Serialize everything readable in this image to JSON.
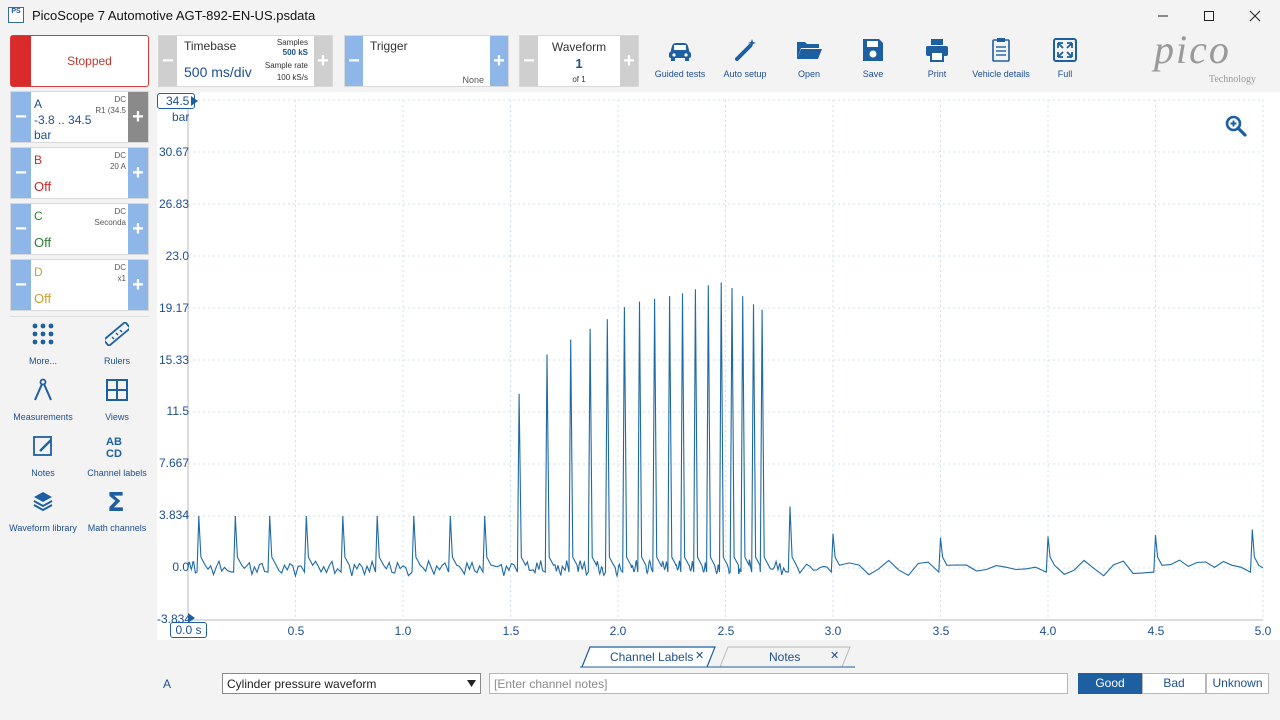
{
  "window": {
    "title": "PicoScope 7 Automotive AGT-892-EN-US.psdata",
    "app_icon_text": "PS"
  },
  "toolbar": {
    "run_state": "Stopped",
    "timebase": {
      "label": "Timebase",
      "value": "500 ms/div",
      "samples_label": "Samples",
      "samples_value": "500 kS",
      "sample_rate_label": "Sample rate",
      "sample_rate_value": "100 kS/s"
    },
    "trigger": {
      "label": "Trigger",
      "mode": "None"
    },
    "waveform": {
      "label": "Waveform",
      "index": "1",
      "of": "of 1"
    },
    "buttons": [
      {
        "label": "Guided tests",
        "icon": "car-icon"
      },
      {
        "label": "Auto setup",
        "icon": "magic-wand-icon"
      },
      {
        "label": "Open",
        "icon": "folder-open-icon"
      },
      {
        "label": "Save",
        "icon": "save-icon"
      },
      {
        "label": "Print",
        "icon": "printer-icon"
      },
      {
        "label": "Vehicle details",
        "icon": "clipboard-icon"
      },
      {
        "label": "Full",
        "icon": "fullscreen-icon"
      }
    ],
    "logo": {
      "text": "pico",
      "sub": "Technology"
    }
  },
  "channels": [
    {
      "name": "A",
      "coupling": "DC",
      "probe": "R1 (34.5",
      "range": "-3.8 .. 34.5",
      "unit": "bar",
      "color": "#1d4f91"
    },
    {
      "name": "B",
      "coupling": "DC",
      "probe": "20 A",
      "state": "Off",
      "color": "#c62828"
    },
    {
      "name": "C",
      "coupling": "DC",
      "probe": "Seconda",
      "state": "Off",
      "color": "#2e7d32"
    },
    {
      "name": "D",
      "coupling": "DC",
      "probe": "x1",
      "state": "Off",
      "color": "#c8a032"
    }
  ],
  "tools": [
    {
      "label": "More...",
      "icon": "grid-dots-icon"
    },
    {
      "label": "Rulers",
      "icon": "ruler-icon"
    },
    {
      "label": "Measurements",
      "icon": "compass-icon"
    },
    {
      "label": "Views",
      "icon": "views-grid-icon"
    },
    {
      "label": "Notes",
      "icon": "notes-icon"
    },
    {
      "label": "Channel labels",
      "icon": "abcd-icon"
    },
    {
      "label": "Waveform library",
      "icon": "library-icon"
    },
    {
      "label": "Math channels",
      "icon": "sigma-icon"
    }
  ],
  "plot": {
    "y_top_label": "34.5",
    "y_unit": "bar",
    "y_ticks": [
      "30.67",
      "26.83",
      "23.0",
      "19.17",
      "15.33",
      "11.5",
      "7.667",
      "3.834",
      "0.0",
      "-3.834"
    ],
    "x_ticks": [
      "0.0 s",
      "0.5",
      "1.0",
      "1.5",
      "2.0",
      "2.5",
      "3.0",
      "3.5",
      "4.0",
      "4.5",
      "5.0"
    ],
    "trace_color": "#1f6aa5",
    "grid_color": "#cfe0ea"
  },
  "chart_data": {
    "type": "line",
    "title": "",
    "xlabel": "s",
    "ylabel": "bar",
    "xlim": [
      0,
      5
    ],
    "ylim": [
      -3.834,
      34.5
    ],
    "series": [
      {
        "name": "A",
        "x": [
          0.05,
          0.22,
          0.38,
          0.55,
          0.72,
          0.88,
          1.05,
          1.22,
          1.38,
          1.54,
          1.67,
          1.78,
          1.87,
          1.95,
          2.03,
          2.1,
          2.17,
          2.24,
          2.3,
          2.36,
          2.42,
          2.48,
          2.53,
          2.58,
          2.63,
          2.67,
          2.8,
          3.0,
          3.5,
          4.0,
          4.5,
          4.95
        ],
        "values": [
          3.8,
          3.8,
          3.8,
          3.8,
          3.8,
          3.8,
          3.8,
          3.8,
          3.8,
          12.8,
          15.7,
          16.8,
          17.6,
          18.3,
          19.2,
          19.6,
          19.8,
          20.0,
          20.2,
          20.5,
          20.8,
          21.0,
          20.6,
          20.0,
          19.4,
          19.0,
          4.5,
          2.5,
          2.2,
          2.3,
          2.4,
          2.8
        ]
      }
    ]
  },
  "bottom": {
    "tabs": [
      "Channel Labels",
      "Notes"
    ],
    "channel": "A",
    "label_select": "Cylinder pressure waveform",
    "notes_placeholder": "[Enter channel notes]",
    "ratings": [
      "Good",
      "Bad",
      "Unknown"
    ],
    "active_rating": "Good"
  }
}
